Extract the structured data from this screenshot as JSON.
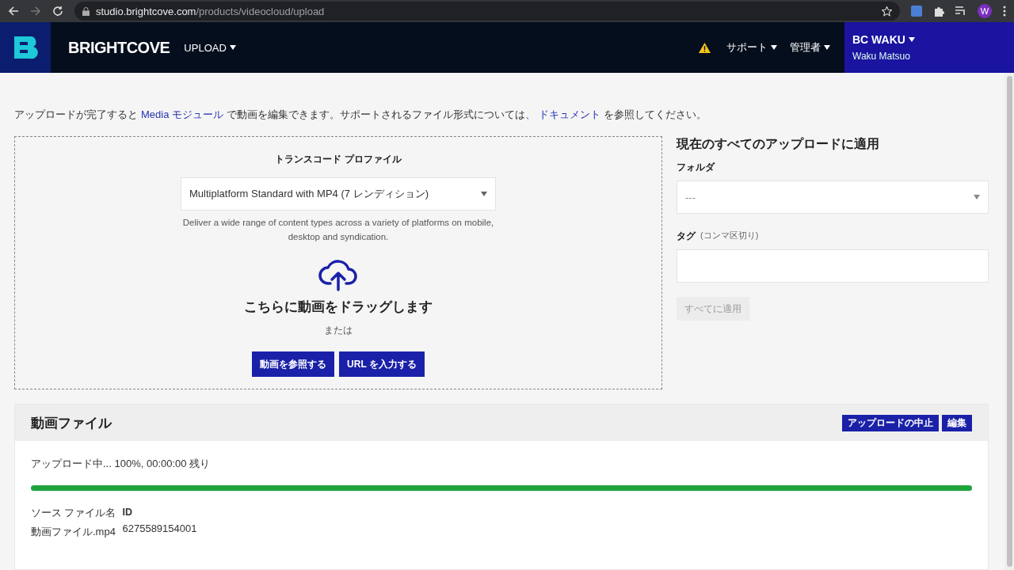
{
  "browser": {
    "url_host": "studio.brightcove.com",
    "url_path": "/products/videocloud/upload",
    "profile_initial": "W"
  },
  "header": {
    "brand": "BRIGHTCOVE",
    "module": "UPLOAD",
    "warning": true,
    "nav": [
      {
        "label": "サポート"
      },
      {
        "label": "管理者"
      }
    ],
    "account": {
      "name": "BC WAKU",
      "user": "Waku Matsuo"
    }
  },
  "intro": [
    {
      "kind": "text",
      "text": "アップロードが完了すると"
    },
    {
      "kind": "link",
      "text": "Media モジュール"
    },
    {
      "kind": "text",
      "text": "で動画を編集できます。サポートされるファイル形式については、"
    },
    {
      "kind": "link",
      "text": "ドキュメント"
    },
    {
      "kind": "text",
      "text": "を参照してください。"
    }
  ],
  "upload": {
    "profile_label": "トランスコード プロファイル",
    "profile": "Multiplatform Standard with MP4 (7 レンディション)",
    "description": "Deliver a wide range of content types across a variety of platforms on mobile, desktop and syndication.",
    "drop_text": "こちらに動画をドラッグします",
    "or": "または",
    "buttons": [
      "動画を参照する",
      "URL を入力する"
    ]
  },
  "apply_all": {
    "title": "現在のすべてのアップロードに適用",
    "folder_label": "フォルダ",
    "folder": "---",
    "tags_label": "タグ",
    "tags_hint": "(コンマ区切り)",
    "button": {
      "label": "すべてに適用",
      "disabled": true
    }
  },
  "files": {
    "title": "動画ファイル",
    "actions": [
      "アップロードの中止",
      "編集"
    ],
    "status": "アップロード中... 100%, 00:00:00 残り",
    "level": 1.0,
    "columns": [
      {
        "heading": "ソース ファイル名",
        "value": "動画ファイル.mp4"
      },
      {
        "heading": "ID",
        "value": "6275589154001"
      }
    ]
  }
}
